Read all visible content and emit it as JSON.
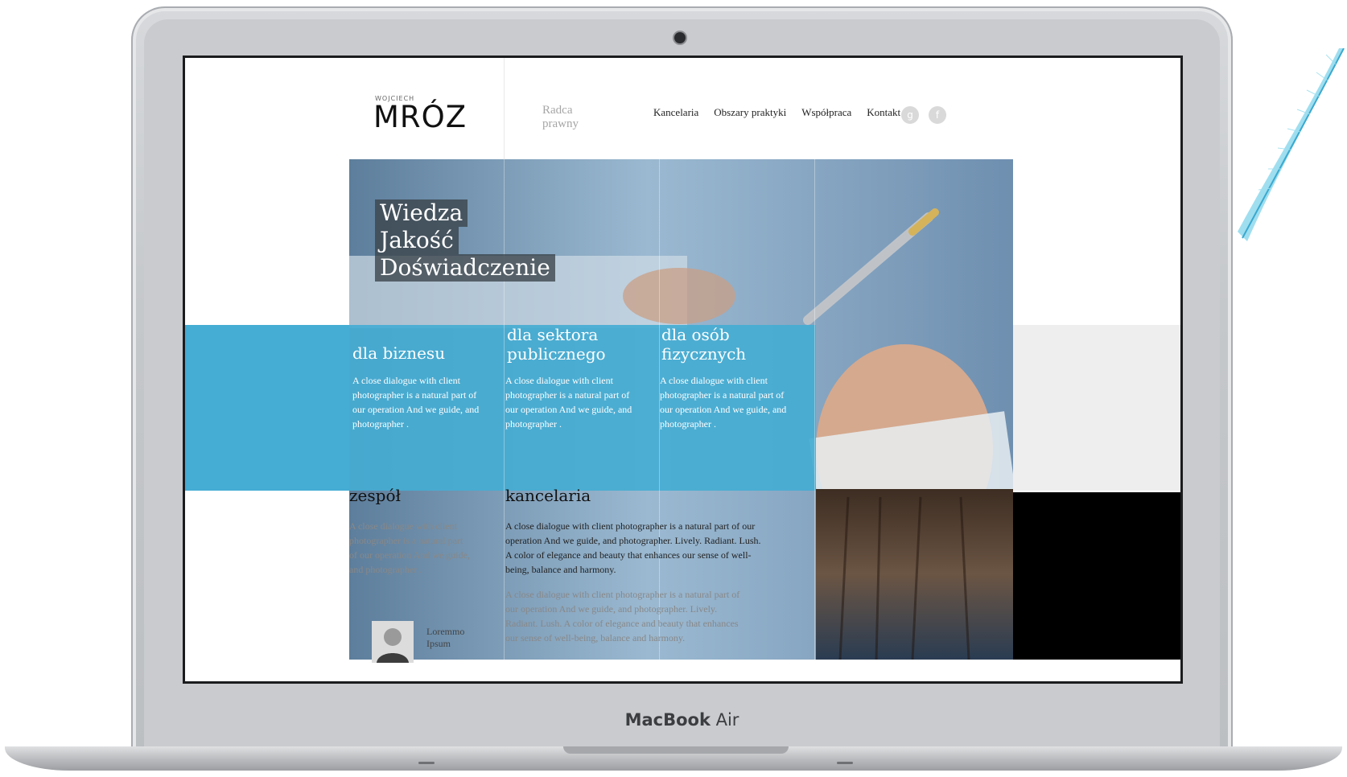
{
  "laptop": {
    "model_brand": "MacBook",
    "model_name": "Air"
  },
  "site": {
    "brand_small": "WOJCIECH",
    "brand_name": "MRÓZ",
    "tagline": "Radca prawny",
    "nav": [
      "Kancelaria",
      "Obszary praktyki",
      "Współpraca",
      "Kontakt"
    ],
    "social": [
      {
        "icon": "google-plus-icon",
        "glyph": "g"
      },
      {
        "icon": "facebook-icon",
        "glyph": "f"
      }
    ],
    "hero": {
      "lines": [
        "Wiedza",
        "Jakość",
        "Doświadczenie"
      ]
    },
    "cards": [
      {
        "title": "dla biznesu",
        "text": "A close dialogue with client photographer is a natural part of our operation And we guide, and photographer ."
      },
      {
        "title": "dla sektora publicznego",
        "text": "A close dialogue with client photographer is a natural part of our operation And we guide, and photographer ."
      },
      {
        "title": "dla osób fizycznych",
        "text": "A close dialogue with client photographer is a natural part of our operation And we guide, and photographer ."
      }
    ],
    "team": {
      "title": "zespół",
      "text": "A close dialogue with client photographer is a natural part of our operation And we guide, and photographer .",
      "person_name": "Loremmo Ipsum"
    },
    "office": {
      "title": "kancelaria",
      "lead": "A close dialogue with client photographer is a natural part of our operation And we guide, and photographer. Lively. Radiant. Lush. A color of elegance and beauty that enhances our sense of well-being, balance and harmony.",
      "text": "A close dialogue with client photographer is a natural part of our operation And we guide, and photographer. Lively. Radiant. Lush.  A color of elegance and beauty that enhances our sense of well-being, balance and harmony."
    }
  },
  "colors": {
    "accent_blue": "#45acd3",
    "hero_dark": "#3a4249",
    "laptop_silver": "#c5c8cb"
  }
}
